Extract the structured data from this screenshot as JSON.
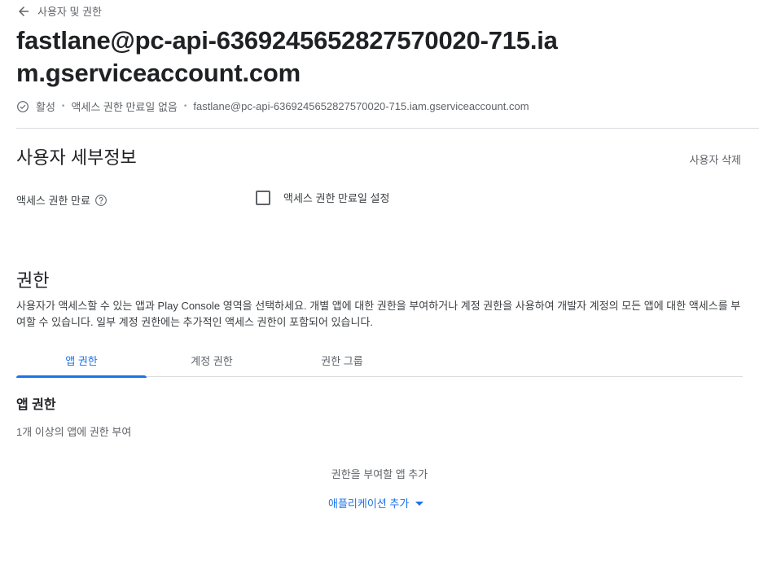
{
  "back": {
    "label": "사용자 및 권한",
    "icon": "arrow-back-icon"
  },
  "title": "fastlane@pc-api-6369245652827570020-715.iam.gserviceaccount.com",
  "meta": {
    "status": "활성",
    "expiry": "액세스 권한 만료일 없음",
    "email": "fastlane@pc-api-6369245652827570020-715.iam.gserviceaccount.com"
  },
  "user_details": {
    "title": "사용자 세부정보",
    "delete_label": "사용자 삭제",
    "expiry_label": "액세스 권한 만료",
    "expiry_checkbox_label": "액세스 권한 만료일 설정",
    "expiry_checked": false
  },
  "permissions": {
    "title": "권한",
    "description": "사용자가 액세스할 수 있는 앱과 Play Console 영역을 선택하세요. 개별 앱에 대한 권한을 부여하거나 계정 권한을 사용하여 개발자 계정의 모든 앱에 대한 액세스를 부여할 수 있습니다. 일부 계정 권한에는 추가적인 액세스 권한이 포함되어 있습니다.",
    "tabs": [
      {
        "label": "앱 권한",
        "active": true
      },
      {
        "label": "계정 권한",
        "active": false
      },
      {
        "label": "권한 그룹",
        "active": false
      }
    ]
  },
  "app_permissions": {
    "title": "앱 권한",
    "description": "1개 이상의 앱에 권한 부여",
    "add_label": "권한을 부여할 앱 추가",
    "add_dropdown_label": "애플리케이션 추가"
  },
  "colors": {
    "accent": "#1a73e8",
    "text": "#202124",
    "muted": "#5f6368",
    "divider": "#dadce0"
  }
}
